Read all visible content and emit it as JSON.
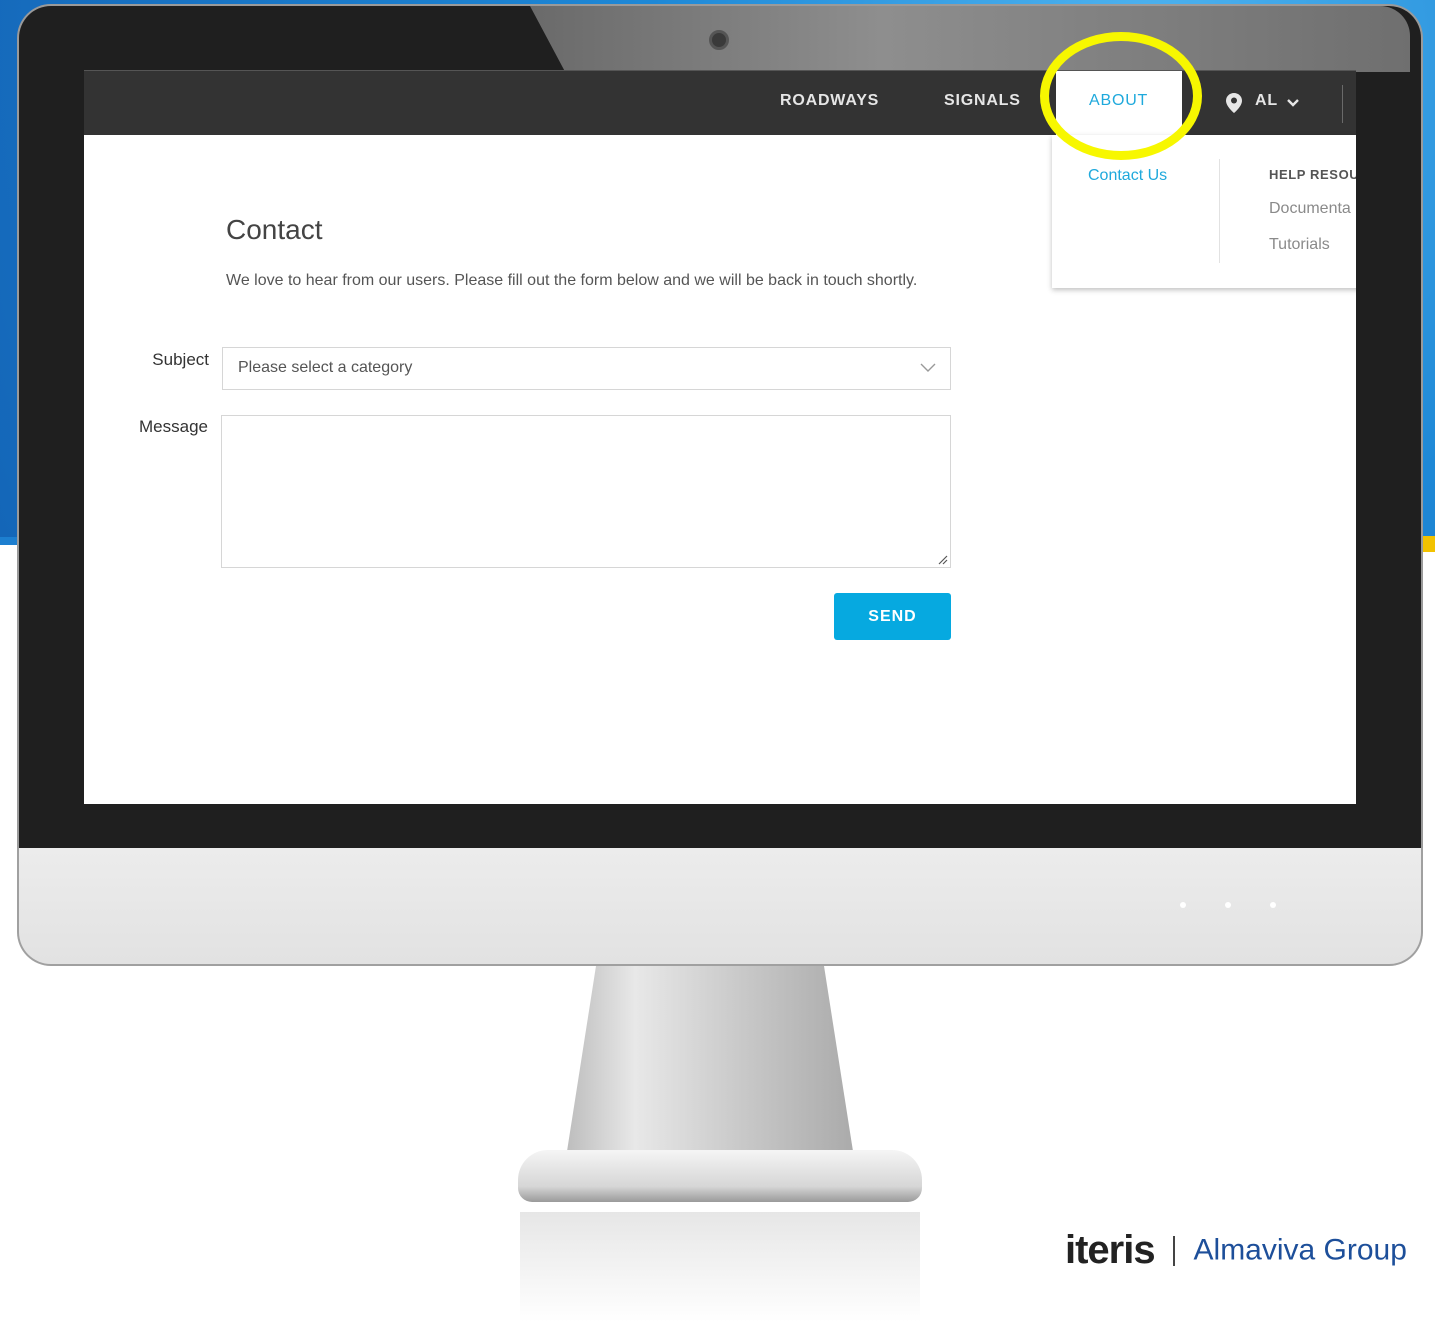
{
  "nav": {
    "items": [
      {
        "label": "ROADWAYS"
      },
      {
        "label": "SIGNALS"
      },
      {
        "label": "ABOUT"
      }
    ],
    "state_label": "AL",
    "icons": {
      "location": "location-pin-icon",
      "chevron": "chevron-down-icon"
    }
  },
  "dropdown": {
    "contact_link": "Contact Us",
    "heading": "HELP RESOU",
    "links": [
      "Documenta",
      "Tutorials"
    ]
  },
  "contact": {
    "title": "Contact",
    "intro": "We love to hear from our users. Please fill out the form below and we will be back in touch shortly.",
    "subject_label": "Subject",
    "subject_value": "Please select a category",
    "message_label": "Message",
    "message_value": "",
    "send_label": "SEND"
  },
  "brand": {
    "main": "iteris",
    "sub": "Almaviva Group"
  },
  "colors": {
    "accent": "#06a9e0",
    "nav_bg": "#333333",
    "highlight": "#f7f700"
  }
}
